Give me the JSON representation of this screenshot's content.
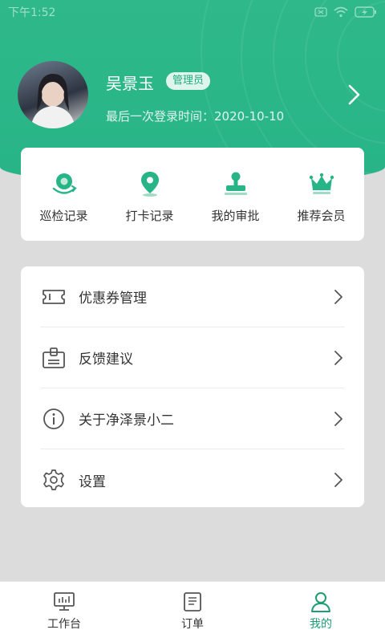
{
  "status_bar": {
    "time": "下午1:52"
  },
  "profile": {
    "name": "吴景玉",
    "role": "管理员",
    "last_login": "最后一次登录时间：2020-10-10"
  },
  "shortcuts": [
    {
      "label": "巡检记录",
      "icon": "patrol-icon"
    },
    {
      "label": "打卡记录",
      "icon": "location-pin-icon"
    },
    {
      "label": "我的审批",
      "icon": "stamp-icon"
    },
    {
      "label": "推荐会员",
      "icon": "crown-icon"
    }
  ],
  "menu": [
    {
      "label": "优惠券管理",
      "icon": "coupon-icon"
    },
    {
      "label": "反馈建议",
      "icon": "feedback-icon"
    },
    {
      "label": "关于净泽景小二",
      "icon": "info-icon"
    },
    {
      "label": "设置",
      "icon": "gear-icon"
    }
  ],
  "tabs": [
    {
      "label": "工作台",
      "icon": "monitor-icon",
      "active": false
    },
    {
      "label": "订单",
      "icon": "document-icon",
      "active": false
    },
    {
      "label": "我的",
      "icon": "user-icon",
      "active": true
    }
  ],
  "colors": {
    "brand": "#27b486",
    "active_tab": "#1d9d72",
    "background": "#dcdcdc"
  }
}
